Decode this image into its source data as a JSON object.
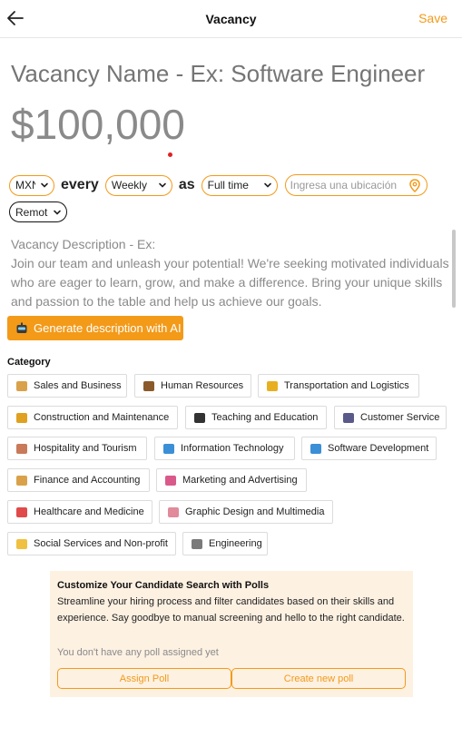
{
  "header": {
    "title": "Vacancy",
    "save_label": "Save"
  },
  "vacancy_name": {
    "placeholder": "Vacancy Name - Ex: Software Engineer"
  },
  "salary": {
    "value": "$100,000"
  },
  "pay": {
    "currency": "MXN",
    "every_label": "every",
    "frequency": "Weekly",
    "as_label": "as",
    "employment_type": "Full time",
    "location_placeholder": "Ingresa una ubicación",
    "work_mode": "Remote"
  },
  "description": {
    "text": "Vacancy Description - Ex:\nJoin our team and unleash your potential! We're seeking motivated individuals who are eager to learn, grow, and make a difference. Bring your unique skills and passion to the table and help us achieve our goals."
  },
  "generate_button": {
    "label": "Generate description with AI"
  },
  "category": {
    "title": "Category",
    "items": [
      {
        "label": "Sales and Business",
        "icon": "money-bag-icon",
        "color": "#d9a24a"
      },
      {
        "label": "Human Resources",
        "icon": "briefcase-icon",
        "color": "#8a5a2b"
      },
      {
        "label": "Transportation and Logistics",
        "icon": "truck-icon",
        "color": "#e8b020"
      },
      {
        "label": "Construction and Maintenance",
        "icon": "barrier-icon",
        "color": "#e0a020"
      },
      {
        "label": "Teaching and Education",
        "icon": "graduation-cap-icon",
        "color": "#333333"
      },
      {
        "label": "Customer Service",
        "icon": "people-icon",
        "color": "#5a5a8a"
      },
      {
        "label": "Hospitality and Tourism",
        "icon": "hotel-icon",
        "color": "#c87a5a"
      },
      {
        "label": "Information Technology",
        "icon": "laptop-icon",
        "color": "#3b8fd6"
      },
      {
        "label": "Software Development",
        "icon": "computer-icon",
        "color": "#3b8fd6"
      },
      {
        "label": "Finance and Accounting",
        "icon": "money-bag-icon",
        "color": "#d9a24a"
      },
      {
        "label": "Marketing and Advertising",
        "icon": "chart-icon",
        "color": "#d95a8a"
      },
      {
        "label": "Healthcare and Medicine",
        "icon": "pill-icon",
        "color": "#e04a4a"
      },
      {
        "label": "Graphic Design and Multimedia",
        "icon": "palette-icon",
        "color": "#e08a9a"
      },
      {
        "label": "Social Services and Non-profit",
        "icon": "hands-icon",
        "color": "#f0c040"
      },
      {
        "label": "Engineering",
        "icon": "wrench-icon",
        "color": "#7a7a7a"
      }
    ]
  },
  "poll": {
    "title": "Customize Your Candidate Search with Polls",
    "description": "Streamline your hiring process and filter candidates based on their skills and experience. Say goodbye to manual screening and hello to the right candidate.",
    "empty_text": "You don't have any poll assigned yet",
    "assign_label": "Assign Poll",
    "create_label": "Create new poll"
  },
  "colors": {
    "accent": "#f39a19",
    "poll_background": "#fdf1e2",
    "muted_text": "#8a8a8a"
  }
}
